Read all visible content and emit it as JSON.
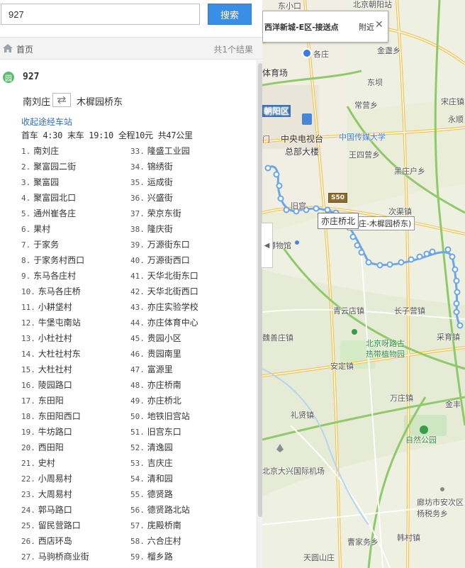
{
  "search": {
    "value": "927",
    "button_label": "搜索"
  },
  "crumb": {
    "home_label": "首页",
    "result_count": "共1个结果"
  },
  "route": {
    "icon_label": "园",
    "name": "927",
    "from": "南刘庄",
    "to": "木樨园桥东",
    "collapse_label": "收起途经车站",
    "schedule": "首车 4:30 末车 19:10 全程10元 共47公里"
  },
  "stops_left": [
    {
      "num": "1.",
      "name": "南刘庄"
    },
    {
      "num": "2.",
      "name": "聚富园二街"
    },
    {
      "num": "3.",
      "name": "聚富园"
    },
    {
      "num": "4.",
      "name": "聚富园北口"
    },
    {
      "num": "5.",
      "name": "通州崔各庄"
    },
    {
      "num": "6.",
      "name": "果村"
    },
    {
      "num": "7.",
      "name": "于家务"
    },
    {
      "num": "8.",
      "name": "于家务村西口"
    },
    {
      "num": "9.",
      "name": "东马各庄村"
    },
    {
      "num": "10.",
      "name": "东马各庄桥"
    },
    {
      "num": "11.",
      "name": "小耕垡村"
    },
    {
      "num": "12.",
      "name": "牛堡屯南站"
    },
    {
      "num": "13.",
      "name": "小杜社村"
    },
    {
      "num": "14.",
      "name": "大杜社村东"
    },
    {
      "num": "15.",
      "name": "大杜社村"
    },
    {
      "num": "16.",
      "name": "陵园路口"
    },
    {
      "num": "17.",
      "name": "东田阳"
    },
    {
      "num": "18.",
      "name": "东田阳西口"
    },
    {
      "num": "19.",
      "name": "牛坊路口"
    },
    {
      "num": "20.",
      "name": "西田阳"
    },
    {
      "num": "21.",
      "name": "史村"
    },
    {
      "num": "22.",
      "name": "小周易村"
    },
    {
      "num": "23.",
      "name": "大周易村"
    },
    {
      "num": "24.",
      "name": "郭马路口"
    },
    {
      "num": "25.",
      "name": "留民营路口"
    },
    {
      "num": "26.",
      "name": "西店环岛"
    },
    {
      "num": "27.",
      "name": "马驹桥商业街"
    }
  ],
  "stops_right": [
    {
      "num": "33.",
      "name": "隆盛工业园"
    },
    {
      "num": "34.",
      "name": "锦绣街"
    },
    {
      "num": "35.",
      "name": "运成街"
    },
    {
      "num": "36.",
      "name": "兴盛街"
    },
    {
      "num": "37.",
      "name": "荣京东街"
    },
    {
      "num": "38.",
      "name": "隆庆街"
    },
    {
      "num": "39.",
      "name": "万源街东口"
    },
    {
      "num": "40.",
      "name": "万源街西口"
    },
    {
      "num": "41.",
      "name": "天华北街东口"
    },
    {
      "num": "42.",
      "name": "天华北街西口"
    },
    {
      "num": "43.",
      "name": "亦庄实验学校"
    },
    {
      "num": "44.",
      "name": "亦庄体育中心"
    },
    {
      "num": "45.",
      "name": "贵园小区"
    },
    {
      "num": "46.",
      "name": "贵园南里"
    },
    {
      "num": "47.",
      "name": "富源里"
    },
    {
      "num": "48.",
      "name": "亦庄桥南"
    },
    {
      "num": "49.",
      "name": "亦庄桥北"
    },
    {
      "num": "50.",
      "name": "地铁旧宫站"
    },
    {
      "num": "51.",
      "name": "旧宫东口"
    },
    {
      "num": "52.",
      "name": "清逸园"
    },
    {
      "num": "53.",
      "name": "吉庆庄"
    },
    {
      "num": "54.",
      "name": "清和园"
    },
    {
      "num": "55.",
      "name": "德贤路"
    },
    {
      "num": "56.",
      "name": "德贤路北站"
    },
    {
      "num": "57.",
      "name": "庑殿桥南"
    },
    {
      "num": "58.",
      "name": "六合庄村"
    },
    {
      "num": "59.",
      "name": "榴乡路"
    }
  ],
  "map": {
    "popup_title": "西洋新城-E区-接送点",
    "popup_suffix": "附近",
    "station_tag": "亦庄桥北",
    "route_tag": "刘庄-木樨园桥东)",
    "road_badge": "S50",
    "labels": {
      "l1": "东小口",
      "l2": "北京朝阳站",
      "l3": "各庄",
      "l4": "金盏乡",
      "l5": "体育场",
      "l6": "东坝",
      "l7": "宋庄镇",
      "l8": "朝阳区",
      "l9": "常营乡",
      "l10": "永顺",
      "l11": "中央电视台",
      "l12": "总部大楼",
      "l13": "中国传媒大学",
      "l14": "王四营乡",
      "l15": "黑庄户乡",
      "l16": "次渠镇",
      "l17": "博物馆",
      "l18": "旧宫",
      "l19": "青云店镇",
      "l20": "长子营镇",
      "l21": "魏善庄镇",
      "l22": "采育镇",
      "l23": "北京呀路古",
      "l24": "热带植物园",
      "l25": "安定镇",
      "l26": "万庄镇",
      "l27": "礼贤镇",
      "l28": "金丰",
      "l29": "自然公园",
      "l30": "北京大兴国际机场",
      "l31": "廊坊市安次区",
      "l32": "杨税务乡",
      "l33": "韩村镇",
      "l34": "曹家务乡",
      "l35": "天圆山庄",
      "l36": "门"
    }
  },
  "colors": {
    "accent": "#3b8ee6",
    "route_line": "#6aa6e8",
    "link": "#2f6fbf"
  }
}
